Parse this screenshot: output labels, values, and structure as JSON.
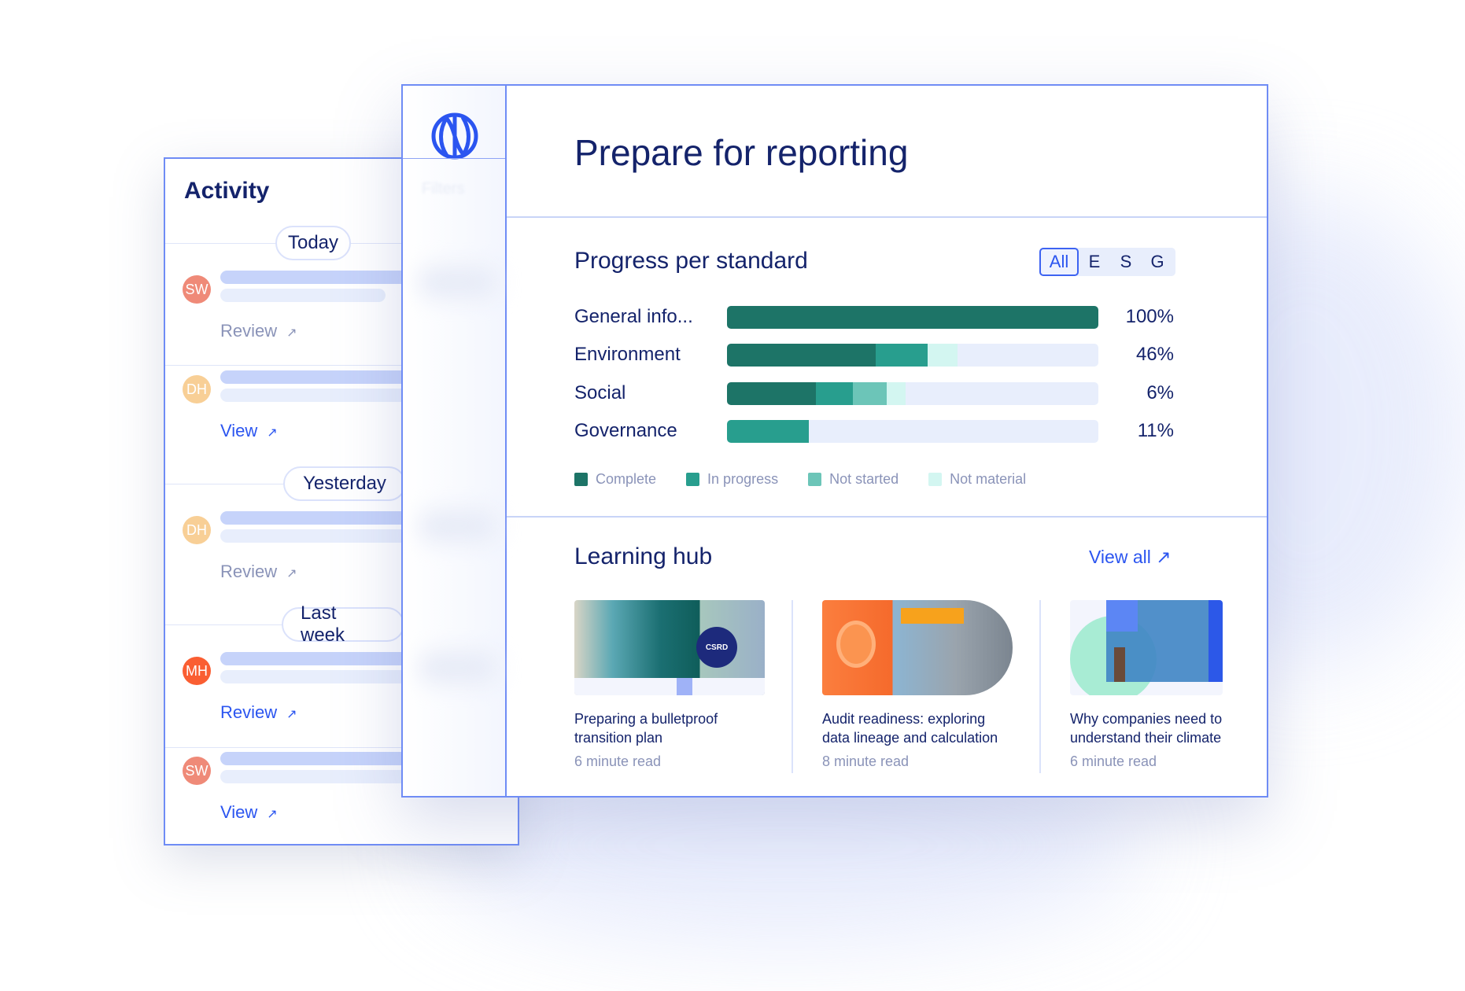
{
  "activity": {
    "title": "Activity",
    "groups": [
      "Today",
      "Yesterday",
      "Last week"
    ],
    "items": [
      {
        "initials": "SW",
        "color": "#ef8a78",
        "link": "Review",
        "link_state": "muted"
      },
      {
        "initials": "DH",
        "color": "#f8cf96",
        "link": "View",
        "link_state": "active"
      },
      {
        "initials": "DH",
        "color": "#f8cf96",
        "link": "Review",
        "link_state": "muted"
      },
      {
        "initials": "MH",
        "color": "#fa5e32",
        "link": "Review",
        "link_state": "active"
      },
      {
        "initials": "SW",
        "color": "#ef8a78",
        "link": "View",
        "link_state": "active"
      }
    ],
    "link_icon": "arrow-up-right-icon"
  },
  "sidebar": {
    "logo": "globe-logo-icon",
    "filters_label": "Filters"
  },
  "header": {
    "title": "Prepare for reporting"
  },
  "progress": {
    "title": "Progress per standard",
    "filters": [
      "All",
      "E",
      "S",
      "G"
    ],
    "selected_filter": "All",
    "colors": {
      "complete": "#1d7467",
      "in_progress": "#289e8e",
      "not_started": "#6cc5b8",
      "not_material": "#d3f6f1",
      "track": "#e8eefc"
    },
    "rows": [
      {
        "label": "General info...",
        "percent": "100%",
        "segments": {
          "complete": 1.0,
          "in_progress": 0,
          "not_started": 0,
          "not_material": 0
        }
      },
      {
        "label": "Environment",
        "percent": "46%",
        "segments": {
          "complete": 0.4,
          "in_progress": 0.14,
          "not_started": 0,
          "not_material": 0.08
        }
      },
      {
        "label": "Social",
        "percent": "6%",
        "segments": {
          "complete": 0.24,
          "in_progress": 0.1,
          "not_started": 0.09,
          "not_material": 0.05
        }
      },
      {
        "label": "Governance",
        "percent": "11%",
        "segments": {
          "complete": 0,
          "in_progress": 0.22,
          "not_started": 0,
          "not_material": 0
        }
      }
    ],
    "legend": [
      "Complete",
      "In progress",
      "Not started",
      "Not material"
    ]
  },
  "learning": {
    "title": "Learning hub",
    "view_all": "View all",
    "cards": [
      {
        "title": "Preparing a bulletproof transition plan",
        "read": "6 minute read",
        "badge": "CSRD"
      },
      {
        "title": "Audit readiness: exploring data lineage and calculation",
        "read": "8 minute read"
      },
      {
        "title": "Why companies need to understand their climate",
        "read": "6 minute read"
      }
    ]
  },
  "accent": "#2b55f0"
}
